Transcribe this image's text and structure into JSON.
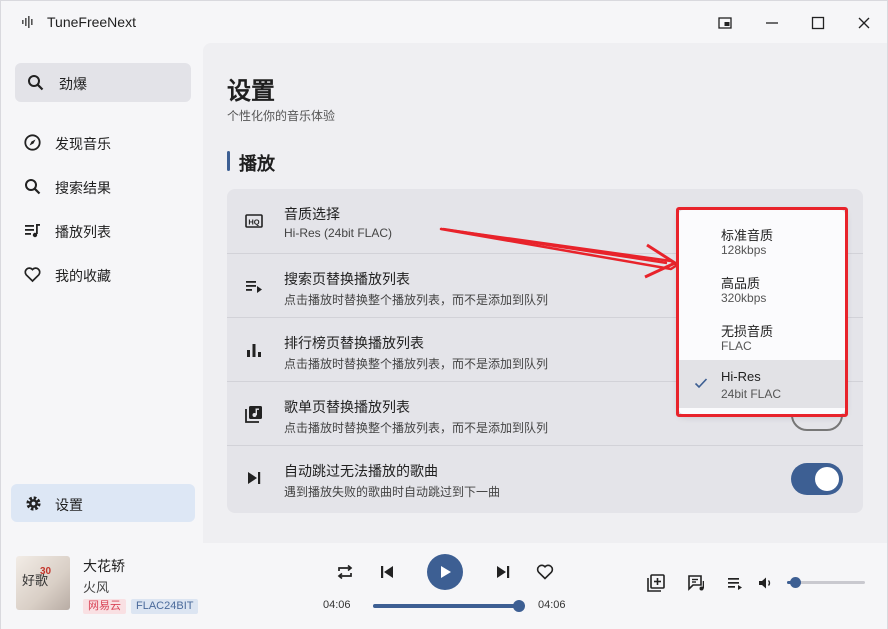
{
  "window": {
    "title": "TuneFreeNext",
    "accent_color": "#3d5f93"
  },
  "sidebar": {
    "search_label": "劲爆",
    "items": [
      {
        "label": "发现音乐",
        "icon": "compass-icon"
      },
      {
        "label": "搜索结果",
        "icon": "search-icon"
      },
      {
        "label": "播放列表",
        "icon": "playlist-icon"
      },
      {
        "label": "我的收藏",
        "icon": "heart-icon"
      }
    ],
    "settings_label": "设置"
  },
  "main": {
    "title": "设置",
    "subtitle": "个性化你的音乐体验",
    "section_title": "播放",
    "rows": [
      {
        "title": "音质选择",
        "desc": "Hi-Res (24bit FLAC)",
        "icon": "hq-icon"
      },
      {
        "title": "搜索页替换播放列表",
        "desc": "点击播放时替换整个播放列表，而不是添加到队列",
        "icon": "queue-play-icon",
        "toggle": true
      },
      {
        "title": "排行榜页替换播放列表",
        "desc": "点击播放时替换整个播放列表，而不是添加到队列",
        "icon": "bar-chart-icon",
        "toggle": true
      },
      {
        "title": "歌单页替换播放列表",
        "desc": "点击播放时替换整个播放列表，而不是添加到队列",
        "icon": "music-library-icon",
        "toggle": false
      },
      {
        "title": "自动跳过无法播放的歌曲",
        "desc": "遇到播放失败的歌曲时自动跳过到下一曲",
        "icon": "skip-next-icon",
        "toggle": true
      }
    ]
  },
  "quality_dropdown": {
    "options": [
      {
        "name": "标准音质",
        "detail": "128kbps",
        "selected": false
      },
      {
        "name": "高品质",
        "detail": "320kbps",
        "selected": false
      },
      {
        "name": "无损音质",
        "detail": "FLAC",
        "selected": false
      },
      {
        "name": "Hi-Res",
        "detail": "24bit FLAC",
        "selected": true
      }
    ],
    "highlight_color": "#e8232b"
  },
  "player": {
    "song_title": "大花轿",
    "artist": "火风",
    "cover_text": "好歌",
    "cover_badge": "30",
    "source_tag": "网易云",
    "format_tag": "FLAC24BIT",
    "time_current": "04:06",
    "time_total": "04:06",
    "progress": 1.0,
    "volume": 0.1
  }
}
